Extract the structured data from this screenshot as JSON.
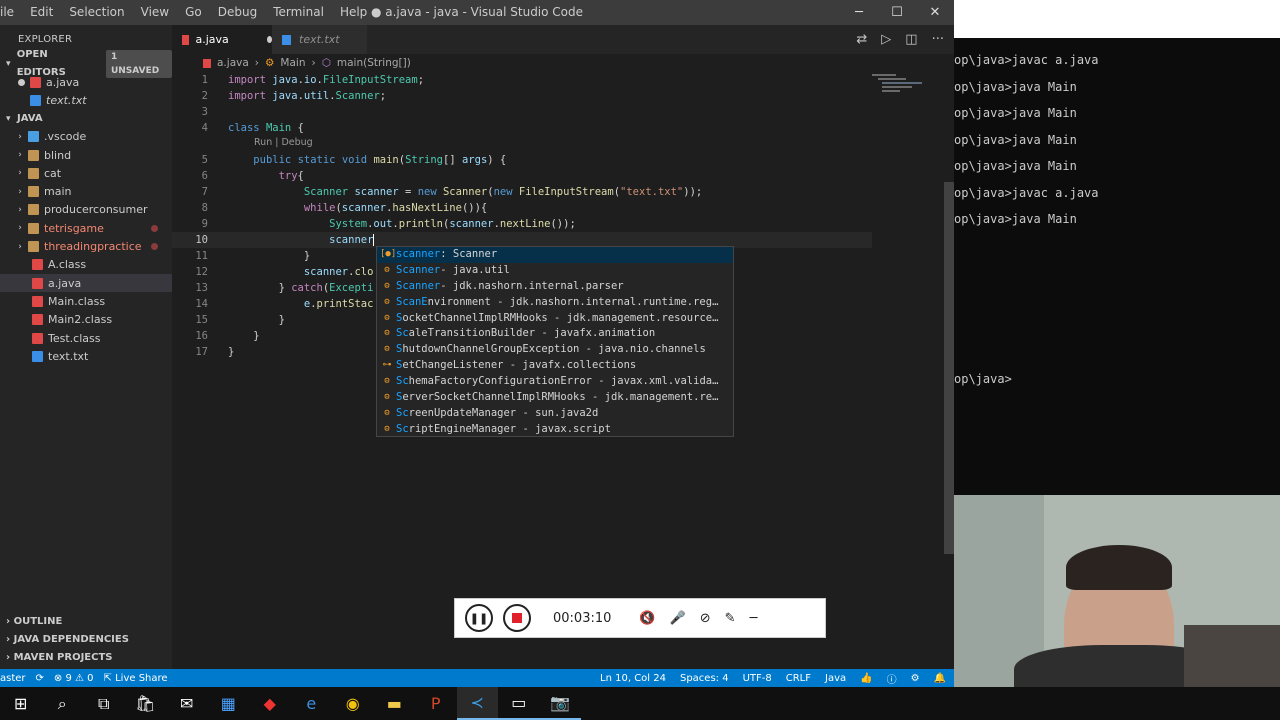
{
  "window": {
    "title": "● a.java - java - Visual Studio Code",
    "menu": [
      "ile",
      "Edit",
      "Selection",
      "View",
      "Go",
      "Debug",
      "Terminal",
      "Help"
    ]
  },
  "sidebar": {
    "title": "EXPLORER",
    "open_editors": {
      "label": "OPEN EDITORS",
      "badge": "1 UNSAVED",
      "items": [
        {
          "name": "a.java"
        },
        {
          "name": "text.txt"
        }
      ]
    },
    "project": {
      "label": "JAVA",
      "items": [
        {
          "name": ".vscode",
          "type": "folder"
        },
        {
          "name": "blind",
          "type": "folder"
        },
        {
          "name": "cat",
          "type": "folder"
        },
        {
          "name": "main",
          "type": "folder"
        },
        {
          "name": "producerconsumer",
          "type": "folder"
        },
        {
          "name": "tetrisgame",
          "type": "folder-red"
        },
        {
          "name": "threadingpractice",
          "type": "folder-red"
        },
        {
          "name": "A.class",
          "type": "class"
        },
        {
          "name": "a.java",
          "type": "java"
        },
        {
          "name": "Main.class",
          "type": "class"
        },
        {
          "name": "Main2.class",
          "type": "class"
        },
        {
          "name": "Test.class",
          "type": "class"
        },
        {
          "name": "text.txt",
          "type": "txt"
        }
      ]
    },
    "bottom": [
      "OUTLINE",
      "JAVA DEPENDENCIES",
      "MAVEN PROJECTS"
    ]
  },
  "tabs": [
    {
      "label": "a.java"
    },
    {
      "label": "text.txt"
    }
  ],
  "breadcrumb": [
    "a.java",
    "Main",
    "main(String[])"
  ],
  "codelens": "Run | Debug",
  "suggestions": [
    {
      "pre": "",
      "hl": "scanner",
      "post": " : Scanner",
      "icon": "[●]"
    },
    {
      "pre": "",
      "hl": "Scanner",
      "post": " - java.util",
      "icon": "⚙"
    },
    {
      "pre": "",
      "hl": "Scanner",
      "post": " - jdk.nashorn.internal.parser",
      "icon": "⚙"
    },
    {
      "pre": "",
      "hl": "ScanE",
      "post": "nvironment - jdk.nashorn.internal.runtime.reg…",
      "icon": "⚙"
    },
    {
      "pre": "",
      "hl": "S",
      "post": "ocketChannelImplRMHooks - jdk.management.resource…",
      "icon": "⚙"
    },
    {
      "pre": "",
      "hl": "Sc",
      "post": "aleTransitionBuilder - javafx.animation",
      "icon": "⚙"
    },
    {
      "pre": "",
      "hl": "S",
      "post": "hutdownChannelGroupException - java.nio.channels",
      "icon": "⚙"
    },
    {
      "pre": "",
      "hl": "S",
      "post": "etChangeListener - javafx.collections",
      "icon": "⊶"
    },
    {
      "pre": "",
      "hl": "Sc",
      "post": "hemaFactoryConfigurationError - javax.xml.valida…",
      "icon": "⚙"
    },
    {
      "pre": "",
      "hl": "S",
      "post": "erverSocketChannelImplRMHooks - jdk.management.re…",
      "icon": "⚙"
    },
    {
      "pre": "",
      "hl": "Sc",
      "post": "reenUpdateManager - sun.java2d",
      "icon": "⚙"
    },
    {
      "pre": "",
      "hl": "Sc",
      "post": "riptEngineManager - javax.script",
      "icon": "⚙"
    }
  ],
  "statusbar": {
    "branch": "aster",
    "errors": "⊗ 9 ⚠ 0",
    "liveshare": "Live Share",
    "position": "Ln 10, Col 24",
    "spaces": "Spaces: 4",
    "encoding": "UTF-8",
    "eol": "CRLF",
    "language": "Java"
  },
  "terminal": {
    "lines": [
      "op\\java>javac a.java",
      "op\\java>java Main",
      "op\\java>java Main",
      "op\\java>java Main",
      "op\\java>java Main",
      "op\\java>javac a.java",
      "op\\java>java Main",
      "op\\java>"
    ]
  },
  "recorder": {
    "time": "00:03:10"
  }
}
